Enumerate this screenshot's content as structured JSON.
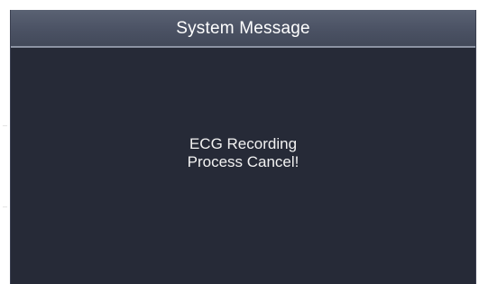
{
  "dialog": {
    "title": "System Message",
    "message_line1": "ECG Recording",
    "message_line2": "Process Cancel!"
  },
  "colors": {
    "dialog_background": "#262a37",
    "titlebar": "#4b5264",
    "title_text": "#ffffff",
    "message_text": "#f2f2f2"
  }
}
